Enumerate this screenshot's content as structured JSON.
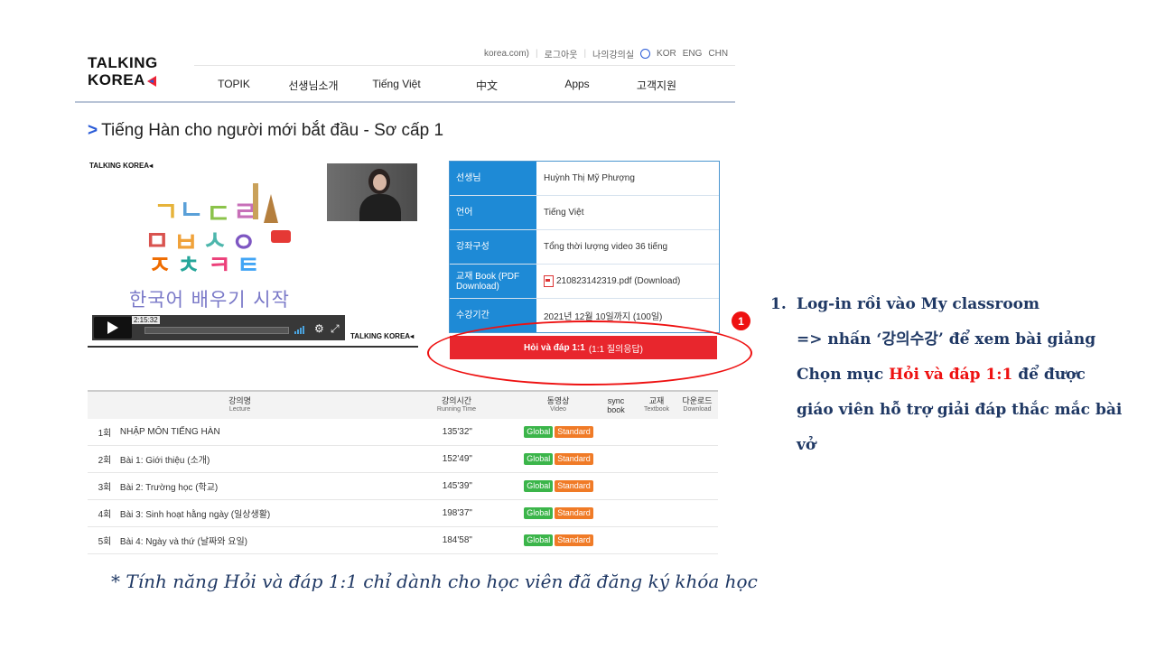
{
  "header": {
    "logo_line1": "TALKING",
    "logo_line2": "KOREA",
    "top_links": [
      "korea.com)",
      "로그아웃",
      "나의강의실",
      "KOR",
      "ENG",
      "CHN"
    ],
    "nav": [
      "TOPIK",
      "선생님소개",
      "Tiếng Việt",
      "中文",
      "Apps",
      "고객지원"
    ]
  },
  "course": {
    "title": "Tiếng Hàn cho người mới bắt đầu - Sơ cấp 1"
  },
  "video": {
    "brand": "TALKING KOREA",
    "caption": "한국어 배우기 시작",
    "timecode": "2:15:32"
  },
  "info": {
    "rows": [
      {
        "key": "선생님",
        "value": "Huỳnh Thị Mỹ Phượng"
      },
      {
        "key": "언어",
        "value": "Tiếng Việt"
      },
      {
        "key": "강좌구성",
        "value": "Tổng thời lượng video 36 tiếng"
      },
      {
        "key": "교재 Book (PDF Download)",
        "value": "210823142319.pdf (Download)"
      },
      {
        "key": "수강기간",
        "value": "2021년 12월 10일까지 (100일)"
      }
    ],
    "qa_button": "Hỏi và đáp 1:1",
    "qa_button_sub": "(1:1 질의응답)",
    "annotation_number": "1"
  },
  "lectures": {
    "headers": {
      "lecture": "강의명",
      "lecture_en": "Lecture",
      "time": "강의시간",
      "time_en": "Running Time",
      "video": "동영상",
      "video_en": "Video",
      "sync": "sync",
      "sync_en": "book",
      "textbook": "교재",
      "textbook_en": "Textbook",
      "download": "다운로드",
      "download_en": "Download"
    },
    "rows": [
      {
        "num": "1회",
        "title": "NHẬP MÔN TIẾNG HÀN",
        "time": "135'32\"",
        "global": "Global",
        "standard": "Standard"
      },
      {
        "num": "2회",
        "title": "Bài 1: Giới thiệu (소개)",
        "time": "152'49\"",
        "global": "Global",
        "standard": "Standard"
      },
      {
        "num": "3회",
        "title": "Bài 2: Trường học (학교)",
        "time": "145'39\"",
        "global": "Global",
        "standard": "Standard"
      },
      {
        "num": "4회",
        "title": "Bài 3: Sinh hoạt hằng ngày (일상생활)",
        "time": "198'37\"",
        "global": "Global",
        "standard": "Standard"
      },
      {
        "num": "5회",
        "title": "Bài 4: Ngày và thứ (날짜와 요일)",
        "time": "184'58\"",
        "global": "Global",
        "standard": "Standard"
      }
    ]
  },
  "footnote": "* Tính năng Hỏi và đáp 1:1 chỉ dành cho học viên đã đăng ký khóa học",
  "instructions": {
    "number": "1.",
    "line1": "Log-in rồi vào My classroom",
    "line2": "=> nhấn ‘강의수강’ để xem bài giảng",
    "line3_pre": "Chọn mục ",
    "line3_red": "Hỏi và đáp 1:1",
    "line3_post": " để được",
    "line4": "giáo viên hỗ trợ giải đáp thắc mắc bài",
    "line5": "vở"
  }
}
